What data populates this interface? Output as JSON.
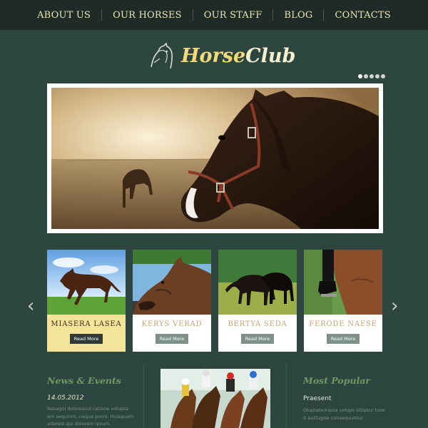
{
  "nav": {
    "items": [
      {
        "label": "About us"
      },
      {
        "label": "Our horses"
      },
      {
        "label": "Our staff"
      },
      {
        "label": "Blog"
      },
      {
        "label": "Contacts"
      }
    ]
  },
  "logo": {
    "part1": "Horse",
    "part2": "Club"
  },
  "slider": {
    "dots": 5,
    "active_dot": 1
  },
  "cards": [
    {
      "title": "Miasera Lasea",
      "button": "Read More"
    },
    {
      "title": "Kerys Verad",
      "button": "Read More"
    },
    {
      "title": "Bertya Seda",
      "button": "Read More"
    },
    {
      "title": "Ferode Naese",
      "button": "Read More"
    }
  ],
  "news": {
    "heading": "News & Events",
    "date": "14.05.2012",
    "text": [
      "Nasagni doloresoul ratione volupta",
      "em sequinnt, neque porro. Huisquam",
      "adarest qui dolorem ipsum."
    ]
  },
  "popular": {
    "heading": "Most Popular",
    "item_title": "Praesent",
    "text": [
      "Oluptatemquia volups sitsptur tose",
      "it autfugise consequuntur."
    ]
  },
  "colors": {
    "accent": "#f4d97a",
    "background": "#2c443e",
    "nav": "#1f2b27",
    "heading_green": "#6f9a63"
  }
}
